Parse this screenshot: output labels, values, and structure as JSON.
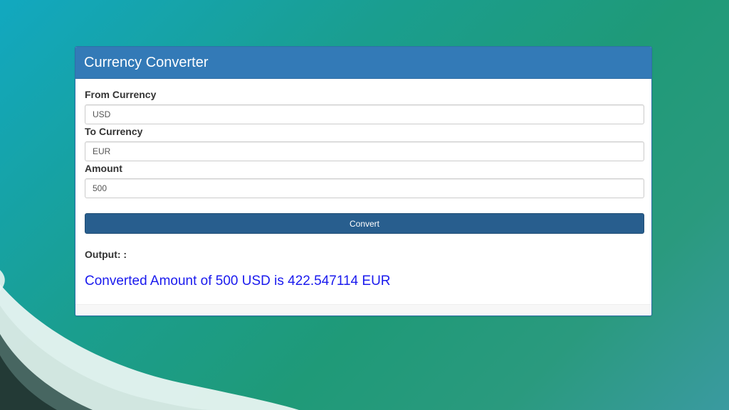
{
  "app": {
    "title": "Currency Converter"
  },
  "form": {
    "from": {
      "label": "From Currency",
      "value": "USD"
    },
    "to": {
      "label": "To Currency",
      "value": "EUR"
    },
    "amount": {
      "label": "Amount",
      "value": "500"
    },
    "convert_label": "Convert"
  },
  "output": {
    "label": "Output: :",
    "result": "Converted Amount of 500 USD is 422.547114 EUR"
  },
  "colors": {
    "header": "#337ab7",
    "button": "#285e8e",
    "result_text": "#1a1aee"
  }
}
